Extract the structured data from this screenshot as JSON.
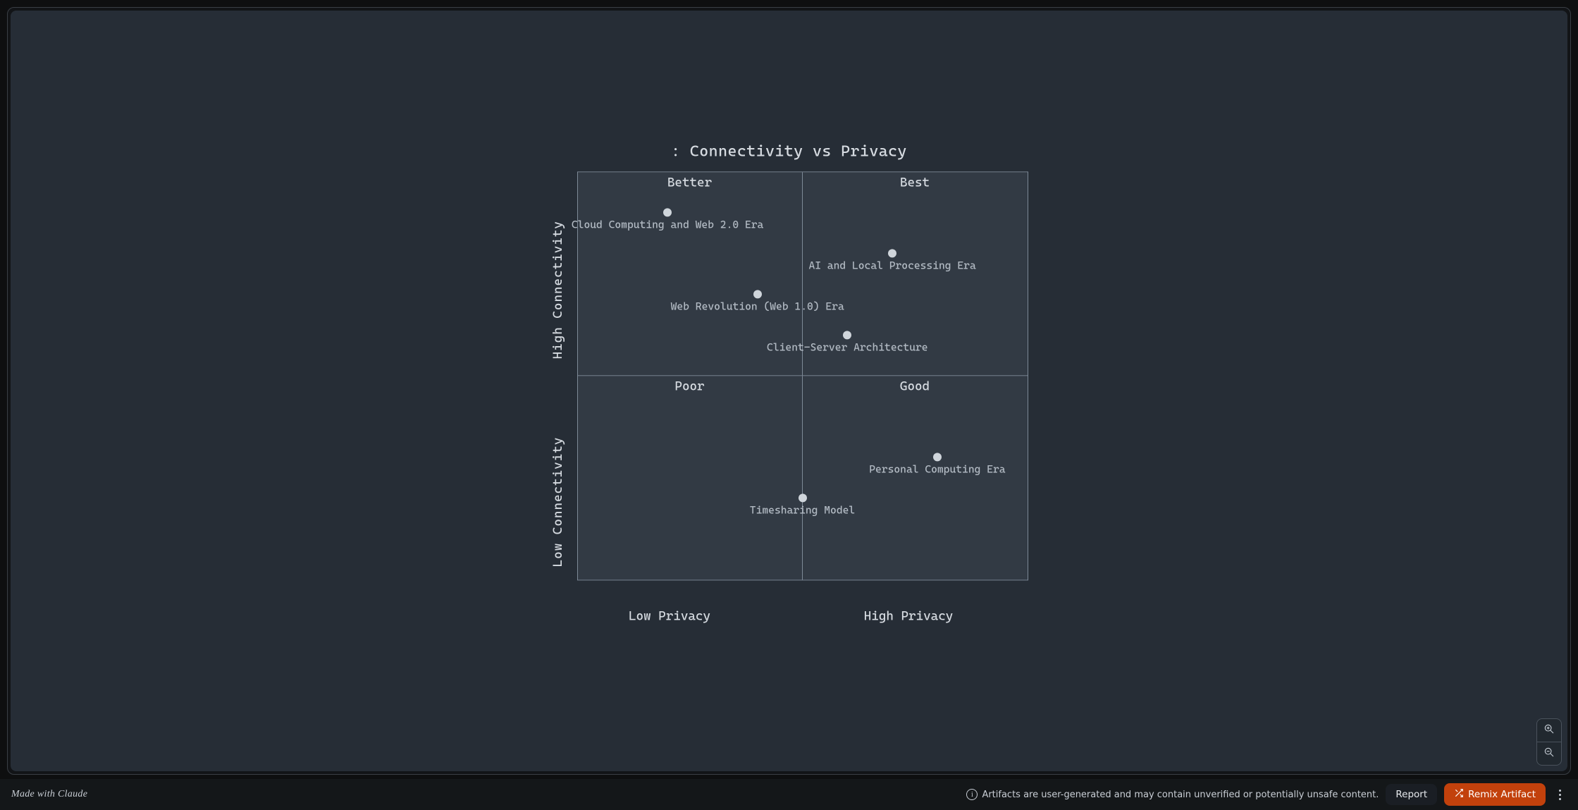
{
  "chart_data": {
    "type": "scatter-quadrant",
    "title": ": Connectivity vs Privacy",
    "x_axis": {
      "dimension": "Privacy",
      "low_label": "Low Privacy",
      "high_label": "High Privacy",
      "range": [
        0,
        10
      ]
    },
    "y_axis": {
      "dimension": "Connectivity",
      "low_label": "Low Connectivity",
      "high_label": "High Connectivity",
      "range": [
        0,
        10
      ]
    },
    "quadrants": {
      "top_left": "Better",
      "top_right": "Best",
      "bottom_left": "Poor",
      "bottom_right": "Good"
    },
    "points": [
      {
        "label": "Cloud Computing and Web 2.0 Era",
        "x": 2.0,
        "y": 9.0
      },
      {
        "label": "AI and Local Processing Era",
        "x": 7.0,
        "y": 8.0
      },
      {
        "label": "Web Revolution (Web 1.0) Era",
        "x": 4.0,
        "y": 7.0
      },
      {
        "label": "Client-Server Architecture",
        "x": 6.0,
        "y": 6.0
      },
      {
        "label": "Personal Computing Era",
        "x": 8.0,
        "y": 3.0
      },
      {
        "label": "Timesharing Model",
        "x": 5.0,
        "y": 2.0
      }
    ]
  },
  "zoom": {
    "in_title": "Zoom in",
    "out_title": "Zoom out"
  },
  "footer": {
    "made_with_prefix": "Made with ",
    "made_with_brand": "Claude",
    "notice": "Artifacts are user-generated and may contain unverified or potentially unsafe content.",
    "report_label": "Report",
    "remix_label": "Remix Artifact"
  }
}
